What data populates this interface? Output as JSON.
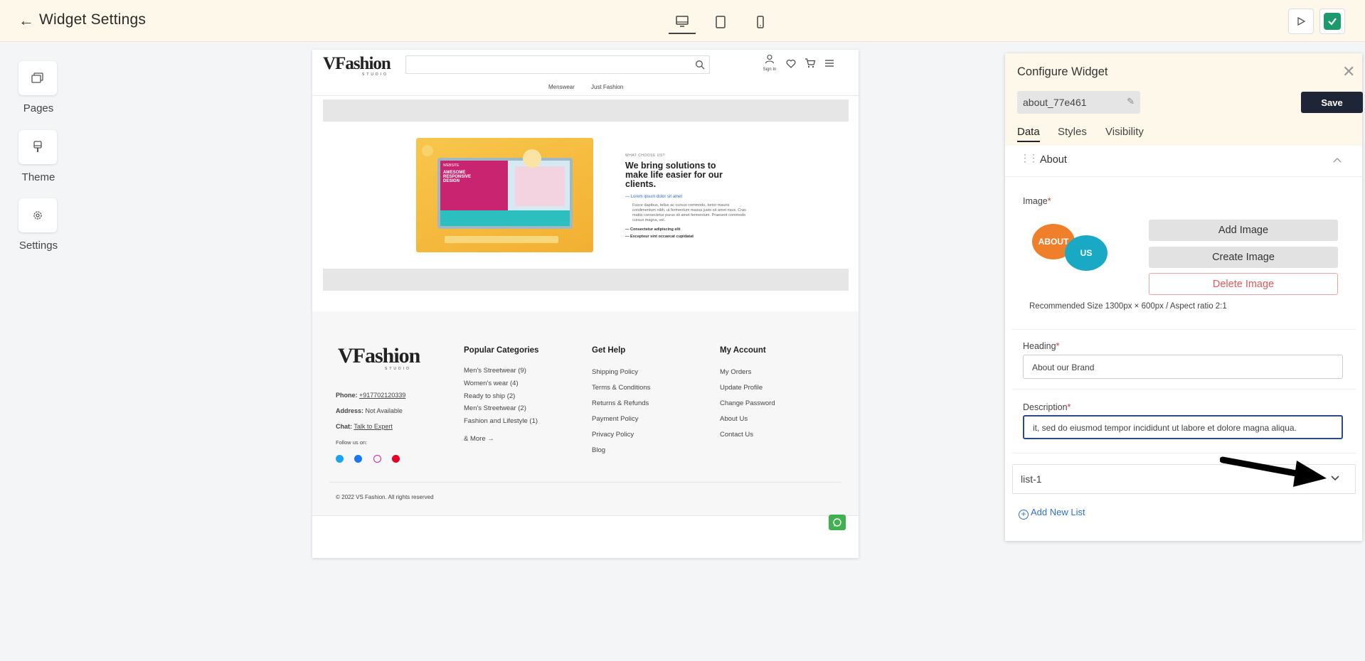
{
  "header": {
    "back_icon": "arrow-left-icon",
    "title": "Widget Settings",
    "devices": [
      "desktop-icon",
      "tablet-icon",
      "mobile-icon"
    ],
    "actions": [
      "play-icon",
      "check-icon"
    ]
  },
  "sidebar": {
    "items": [
      {
        "label": "Pages",
        "icon": "pages-icon"
      },
      {
        "label": "Theme",
        "icon": "brush-icon"
      },
      {
        "label": "Settings",
        "icon": "gear-icon"
      }
    ]
  },
  "preview": {
    "logo_main": "VFashion",
    "logo_sub": "STUDIO",
    "signin": "Sign In",
    "nav": [
      "Menswear",
      "Just Fashion"
    ],
    "about": {
      "eyebrow": "WHAT CHOOSE US?",
      "heading": "We bring solutions to make life easier for our clients.",
      "link": "Lorem ipsum dolor sit amet",
      "body": "Fusce dapibus, tellus ac cursus commodo, tortor mauris condimentum nibh, ut fermentum massa justo sit amet risus. Cras mattis consectetur purus sit amet fermentum. Praesent commodo cursus magna, vel.",
      "bullets": [
        "Consectetur adipiscing elit",
        "Excepteur sint occaecat cupidatat"
      ],
      "image_text": [
        "WEBSITE",
        "AWESOME RESPONSIVE DESIGN"
      ]
    },
    "footer": {
      "phone_label": "Phone:",
      "phone": "+917702120339",
      "address_label": "Address:",
      "address": "Not Available",
      "chat_label": "Chat:",
      "chat": "Talk to Expert",
      "follow": "Follow us on:",
      "columns": [
        {
          "title": "Popular Categories",
          "links": [
            "Men's Streetwear (9)",
            "Women's wear (4)",
            "Ready to ship (2)",
            "Men's Streetwear (2)",
            "Fashion and Lifestyle (1)"
          ],
          "more": "& More"
        },
        {
          "title": "Get Help",
          "links": [
            "Shipping Policy",
            "Terms & Conditions",
            "Returns & Refunds",
            "Payment Policy",
            "Privacy Policy",
            "Blog"
          ]
        },
        {
          "title": "My Account",
          "links": [
            "My Orders",
            "Update Profile",
            "Change Password",
            "About Us",
            "Contact Us"
          ]
        }
      ],
      "copyright": "© 2022 VS Fashion. All rights reserved"
    }
  },
  "panel": {
    "title": "Configure Widget",
    "widget_id": "about_77e461",
    "save": "Save",
    "tabs": [
      "Data",
      "Styles",
      "Visibility"
    ],
    "section": "About",
    "image_label": "Image",
    "required": "*",
    "thumb_text": [
      "ABOUT",
      "US"
    ],
    "add_image": "Add Image",
    "create_image": "Create Image",
    "delete_image": "Delete Image",
    "recommended": "Recommended Size 1300px × 600px / Aspect ratio 2:1",
    "heading_label": "Heading",
    "heading_value": "About our Brand",
    "description_label": "Description",
    "description_value": "it, sed do eiusmod tempor incididunt ut labore et dolore magna aliqua.",
    "list_item": "list-1",
    "add_list": "Add New List"
  },
  "colors": {
    "topbar": "#fdf8e9",
    "save_button": "#1e2536",
    "accent_green": "#1d9a6c",
    "link_blue": "#2f6fd0",
    "delete_red": "#e05a5a"
  }
}
